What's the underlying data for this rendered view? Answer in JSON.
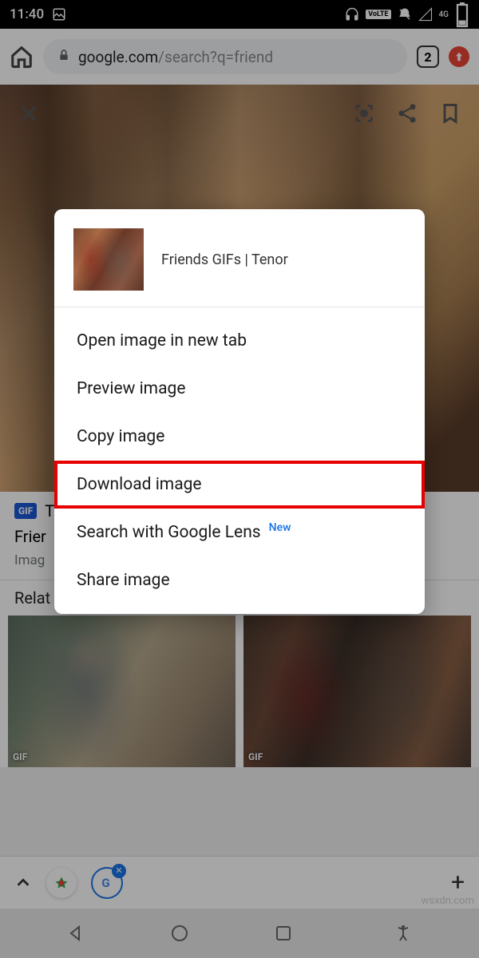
{
  "status": {
    "time": "11:40",
    "volte": "VoLTE",
    "signal": "4G"
  },
  "browser": {
    "url_domain": "google.com",
    "url_path": "/search?q=friend",
    "tab_count": "2"
  },
  "page": {
    "source_prefix": "T",
    "title_partial": "Frier",
    "subtitle_partial": "Imag",
    "related_partial": "Relat",
    "gif_label": "GIF",
    "gif_corner": "GIF"
  },
  "menu": {
    "header_title": "Friends GIFs | Tenor",
    "items": [
      {
        "label": "Open image in new tab"
      },
      {
        "label": "Preview image"
      },
      {
        "label": "Copy image"
      },
      {
        "label": "Download image",
        "highlighted": true
      },
      {
        "label": "Search with Google Lens",
        "badge": "New"
      },
      {
        "label": "Share image"
      }
    ]
  },
  "watermark": "wsxdn.com"
}
